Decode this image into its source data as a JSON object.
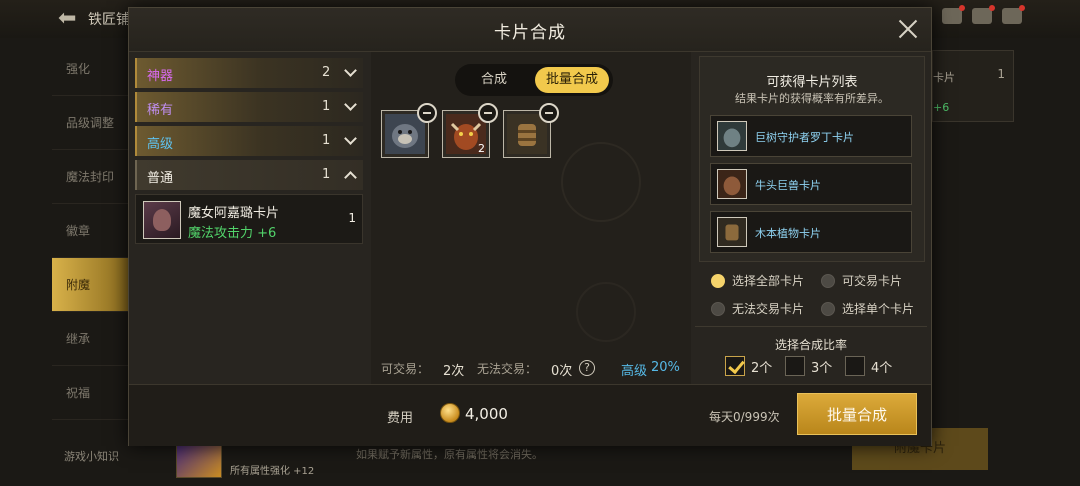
{
  "background": {
    "title": "铁匠铺",
    "sidebar": [
      "强化",
      "品级调整",
      "魔法封印",
      "徽章",
      "附魔",
      "继承",
      "祝福"
    ],
    "active_sidebar_index": 4,
    "right_panel": {
      "label": "卡片",
      "count": "1",
      "bonus": "+6"
    },
    "bottom_left": "游戏小知识",
    "bottom_attr": "所有属性强化 +12",
    "bottom_note": "如果赋予新属性，原有属性将会消失。",
    "bottom_button": "附魔卡片"
  },
  "dialog": {
    "title": "卡片合成",
    "categories": [
      {
        "name": "神器",
        "count": "2",
        "color": "#d96af0",
        "expanded": false
      },
      {
        "name": "稀有",
        "count": "1",
        "color": "#c08ef0",
        "expanded": false
      },
      {
        "name": "高级",
        "count": "1",
        "color": "#5fc3f0",
        "expanded": false
      },
      {
        "name": "普通",
        "count": "1",
        "color": "#f2eee4",
        "expanded": true
      }
    ],
    "card_entry": {
      "name": "魔女阿嘉璐卡片",
      "stat": "魔法攻击力 +6",
      "count": "1"
    },
    "tabs": {
      "single": "合成",
      "batch": "批量合成",
      "active": "batch"
    },
    "slots": [
      {
        "icon": "gorilla-card-icon",
        "qty": ""
      },
      {
        "icon": "minotaur-card-icon",
        "qty": "2"
      },
      {
        "icon": "wooden-golem-card-icon",
        "qty": ""
      }
    ],
    "stats": {
      "tradable_label": "可交易：",
      "tradable_val": "2次",
      "untradable_label": "无法交易：",
      "untradable_val": "0次",
      "help": "?",
      "tier": "高级",
      "tier_rate": "20%"
    },
    "reward_list": {
      "title": "可获得卡片列表",
      "subtitle": "结果卡片的获得概率有所差异。",
      "items": [
        {
          "name": "巨树守护者罗丁卡片",
          "icon": "tree-guardian-card-icon"
        },
        {
          "name": "牛头巨兽卡片",
          "icon": "minotaur-card-icon"
        },
        {
          "name": "木本植物卡片",
          "icon": "wooden-golem-card-icon"
        }
      ]
    },
    "filters": [
      {
        "label": "选择全部卡片",
        "on": true
      },
      {
        "label": "可交易卡片",
        "on": false
      },
      {
        "label": "无法交易卡片",
        "on": false
      },
      {
        "label": "选择单个卡片",
        "on": false
      }
    ],
    "ratio": {
      "title": "选择合成比率",
      "options": [
        {
          "label": "2个",
          "on": true
        },
        {
          "label": "3个",
          "on": false
        },
        {
          "label": "4个",
          "on": false
        }
      ]
    },
    "footer": {
      "fee_label": "费用",
      "fee_value": "4,000",
      "daily": "每天0/999次",
      "button": "批量合成"
    }
  }
}
